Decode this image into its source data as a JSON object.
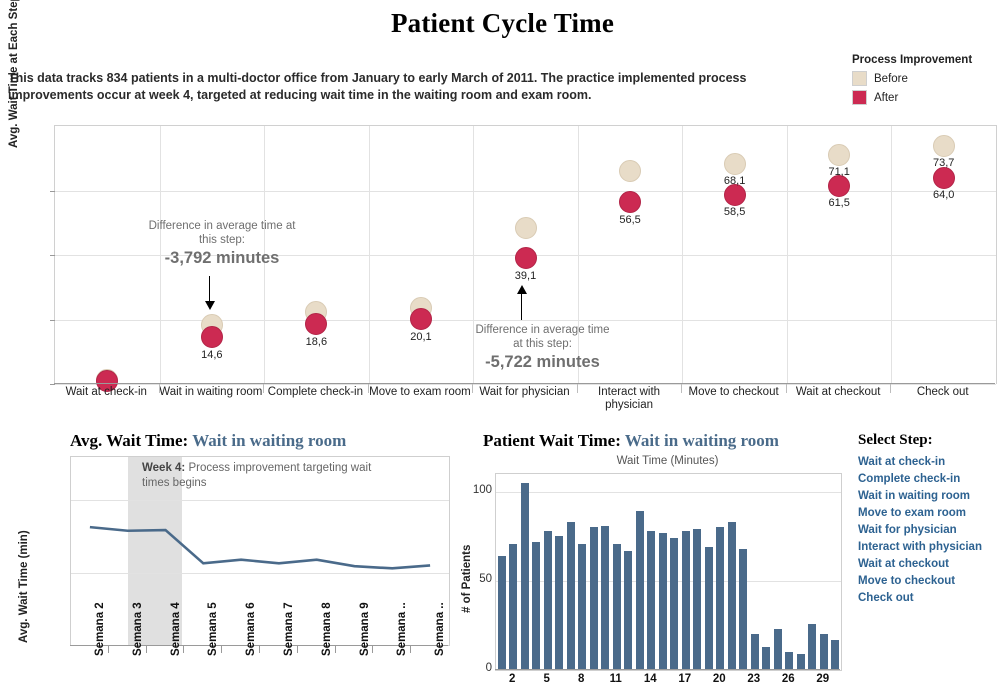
{
  "page_title": "Patient Cycle Time",
  "intro_text": "This data tracks 834 patients in a multi-doctor office from January to early March of 2011. The practice implemented process improvements occur at week 4, targeted at reducing wait time in the waiting room and exam room.",
  "legend": {
    "title": "Process Improvement",
    "items": [
      {
        "label": "Before",
        "color": "#e8dcc8"
      },
      {
        "label": "After",
        "color": "#cc2a52"
      }
    ]
  },
  "colors": {
    "before": "#e8dcc8",
    "after": "#cc2a52",
    "bar": "#4a6a8a",
    "line": "#4a6a8a",
    "link": "#2d6291",
    "annotation": "#6f6f6f"
  },
  "main_chart_annotations": [
    {
      "id": "waiting-room",
      "line1": "Difference in average time at",
      "line2": "this step:",
      "value": "-3,792 minutes",
      "direction": "down"
    },
    {
      "id": "wait-for-physician",
      "line1": "Difference in average time",
      "line2": "at this step:",
      "value": "-5,722 minutes",
      "direction": "up"
    }
  ],
  "line_chart_note": {
    "bold": "Week 4:",
    "text": " Process improvement targeting wait times begins"
  },
  "panels": {
    "line": {
      "title_prefix": "Avg. Wait Time:",
      "title_step": "Wait in waiting room"
    },
    "bar": {
      "title_prefix": "Patient Wait Time:",
      "title_step": "Wait in waiting room",
      "subtitle": "Wait Time (Minutes)"
    }
  },
  "select_step": {
    "title": "Select Step:",
    "items": [
      "Wait at check-in",
      "Complete check-in",
      "Wait in waiting room",
      "Move to exam room",
      "Wait for physician",
      "Interact with physician",
      "Wait at checkout",
      "Move to checkout",
      "Check out"
    ]
  },
  "chart_data": [
    {
      "type": "scatter",
      "id": "patient-cycle-time-dotplot",
      "title": "Patient Cycle Time",
      "xlabel": "",
      "ylabel": "Avg. Wait Time at Each Step (min)",
      "ylim": [
        0,
        80
      ],
      "yticks": [
        0,
        20,
        40,
        60
      ],
      "grid": true,
      "legend_position": "top-right",
      "categories": [
        "Wait at check-in",
        "Wait in waiting room",
        "Complete check-in",
        "Move to exam room",
        "Wait for physician",
        "Interact with physician",
        "Move to checkout",
        "Wait at checkout",
        "Check out"
      ],
      "series": [
        {
          "name": "Before",
          "values": [
            1.2,
            18.3,
            22.2,
            23.6,
            48.4,
            66.2,
            68.1,
            71.1,
            73.7
          ]
        },
        {
          "name": "After",
          "values": [
            1.0,
            14.6,
            18.6,
            20.1,
            39.1,
            56.5,
            58.5,
            61.5,
            64.0
          ]
        }
      ],
      "point_labels": [
        "",
        "14,6",
        "18,6",
        "20,1",
        "39,1",
        "56,5",
        "68,1",
        "71,1",
        "73,7"
      ],
      "point_labels_secondary": [
        "",
        "",
        "",
        "",
        "",
        "",
        "58,5",
        "61,5",
        "64,0"
      ]
    },
    {
      "type": "line",
      "id": "avg-wait-time-by-week",
      "title": "Avg. Wait Time: Wait in waiting room",
      "xlabel": "",
      "ylabel": "Avg. Wait Time (min)",
      "ylim": [
        0,
        26
      ],
      "yticks": [
        0,
        10,
        20
      ],
      "grid": true,
      "categories": [
        "Semana 2",
        "Semana 3",
        "Semana 4",
        "Semana 5",
        "Semana 6",
        "Semana 7",
        "Semana 8",
        "Semana 9",
        "Semana ..",
        "Semana .."
      ],
      "values": [
        16.3,
        15.8,
        15.9,
        11.3,
        11.8,
        11.3,
        11.8,
        10.9,
        10.6,
        11.0
      ],
      "highlight_band": {
        "label": "Week 4",
        "from_index": 2
      }
    },
    {
      "type": "bar",
      "id": "patient-wait-time-histogram",
      "title": "Patient Wait Time: Wait in waiting room",
      "xlabel": "Wait Time (Minutes)",
      "ylabel": "# of Patients",
      "ylim": [
        0,
        110
      ],
      "yticks": [
        0,
        50,
        100
      ],
      "grid": true,
      "categories": [
        1,
        2,
        3,
        4,
        5,
        6,
        7,
        8,
        9,
        10,
        11,
        12,
        13,
        14,
        15,
        16,
        17,
        18,
        19,
        20,
        21,
        22,
        23,
        24,
        25,
        26,
        27,
        28,
        29,
        30
      ],
      "xticks": [
        2,
        5,
        8,
        11,
        14,
        17,
        20,
        23,
        26,
        29
      ],
      "values": [
        64,
        71,
        105,
        72,
        78,
        75,
        83,
        71,
        80,
        81,
        71,
        67,
        89,
        78,
        77,
        74,
        78,
        79,
        69,
        80,
        83,
        68,
        20,
        13,
        23,
        10,
        9,
        26,
        20,
        17
      ]
    }
  ]
}
